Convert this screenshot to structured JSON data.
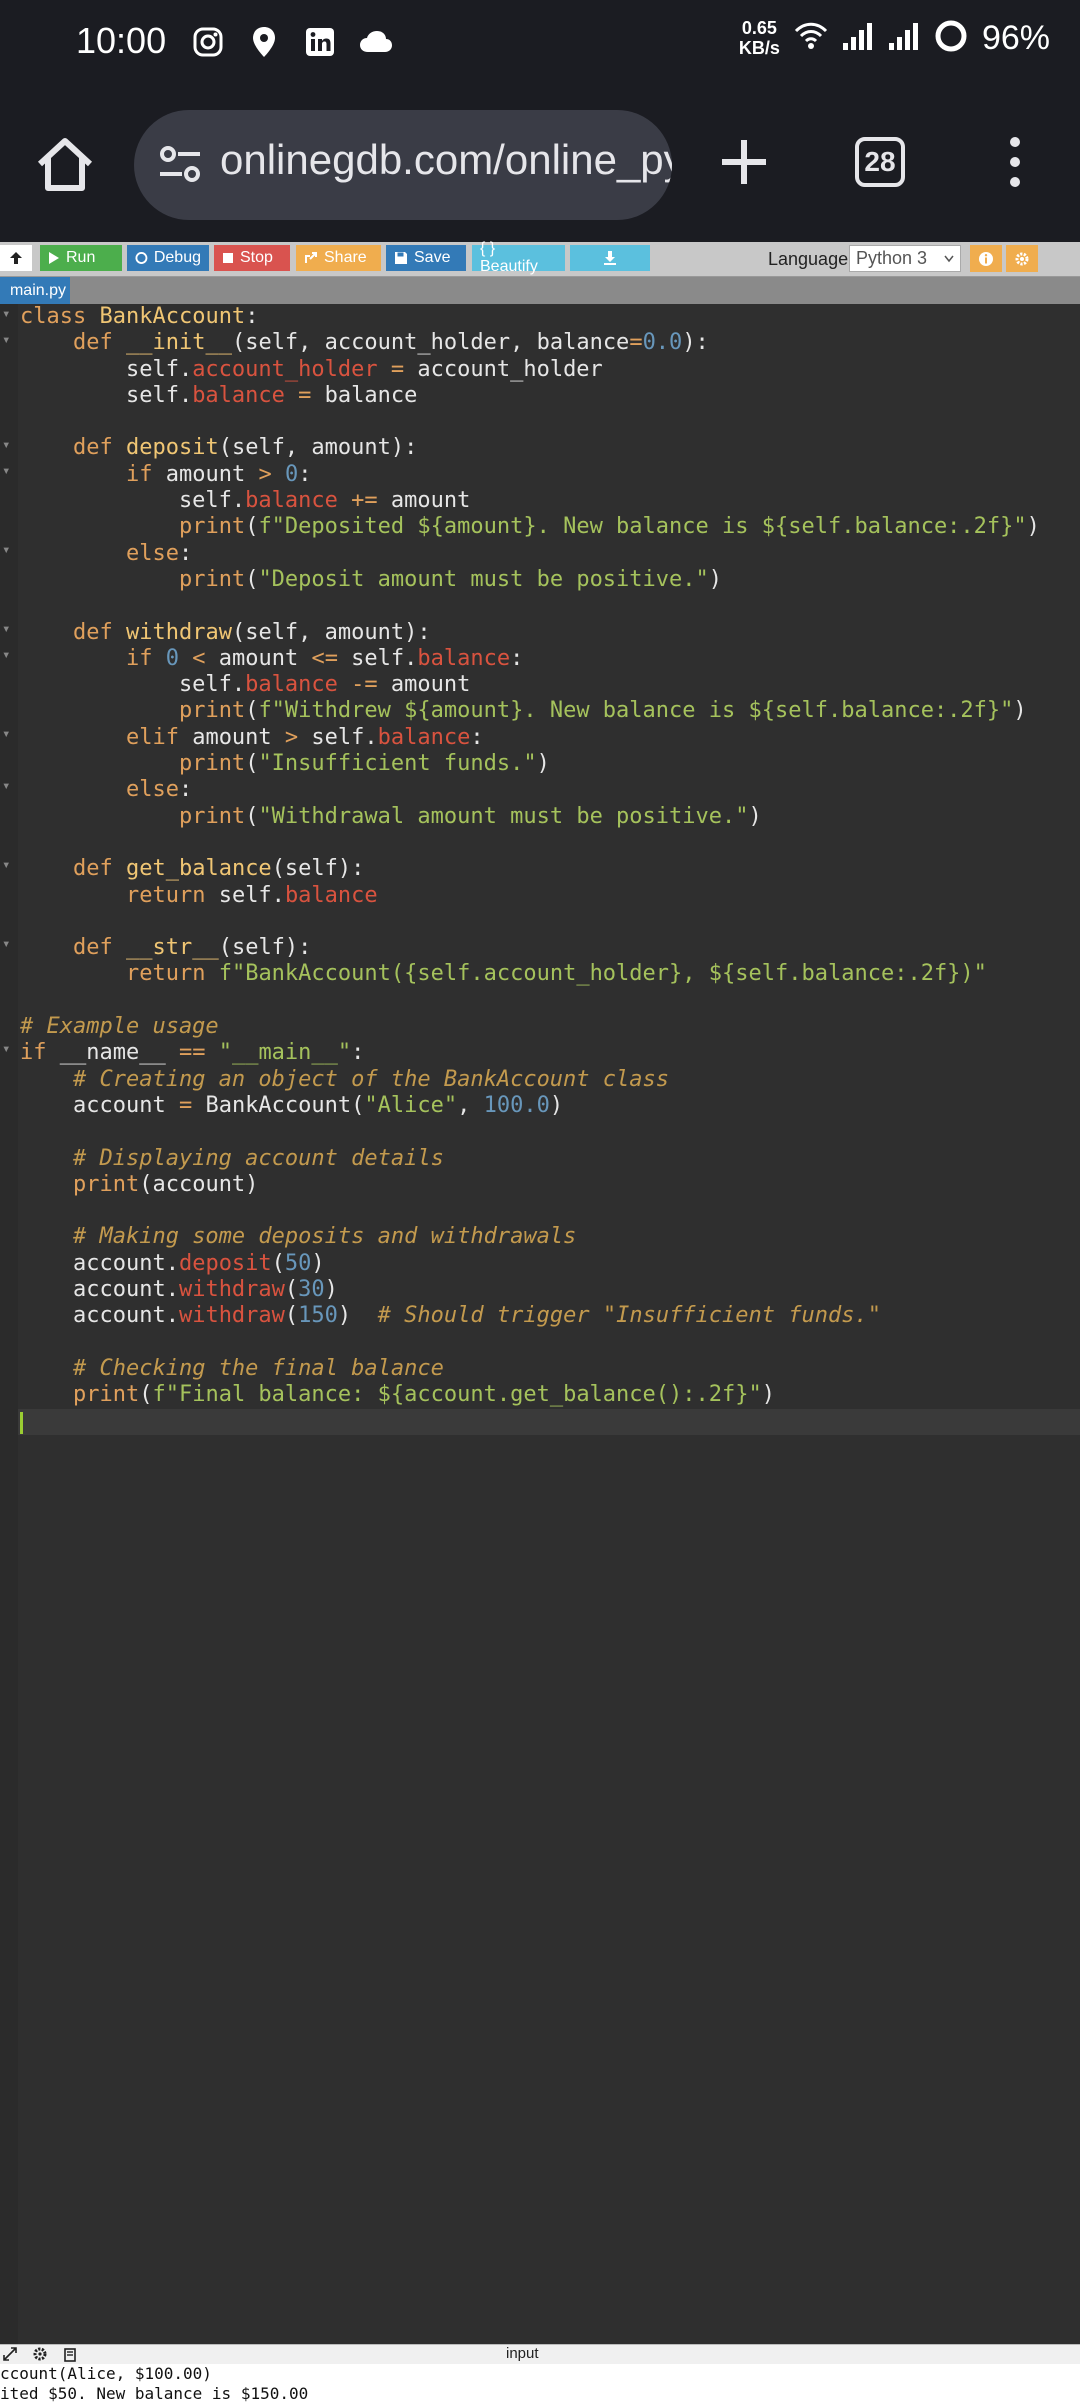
{
  "status_bar": {
    "time": "10:00",
    "speed_value": "0.65",
    "speed_unit": "KB/s",
    "battery": "96%",
    "icons": [
      "instagram-icon",
      "maps-pin-icon",
      "linkedin-icon",
      "cloud-icon",
      "wifi-icon",
      "signal-icon",
      "signal-icon",
      "battery-ring-icon"
    ]
  },
  "browser": {
    "url": "onlinegdb.com/online_python_compiler",
    "tab_count": "28"
  },
  "toolbar": {
    "run": "Run",
    "debug": "Debug",
    "stop": "Stop",
    "share": "Share",
    "save": "Save",
    "beautify": "{ } Beautify",
    "language_label": "Language",
    "language_value": "Python 3",
    "file_tab": "main.py"
  },
  "colors": {
    "run": "#4cae4c",
    "debug": "#337ab7",
    "stop": "#d9534f",
    "share": "#f0ad4e",
    "save": "#337ab7",
    "beautify": "#5bc0de",
    "download": "#5bc0de"
  },
  "code_lines": [
    "class BankAccount:",
    "    def __init__(self, account_holder, balance=0.0):",
    "        self.account_holder = account_holder",
    "        self.balance = balance",
    "",
    "    def deposit(self, amount):",
    "        if amount > 0:",
    "            self.balance += amount",
    "            print(f\"Deposited ${amount}. New balance is ${self.balance:.2f}\")",
    "        else:",
    "            print(\"Deposit amount must be positive.\")",
    "",
    "    def withdraw(self, amount):",
    "        if 0 < amount <= self.balance:",
    "            self.balance -= amount",
    "            print(f\"Withdrew ${amount}. New balance is ${self.balance:.2f}\")",
    "        elif amount > self.balance:",
    "            print(\"Insufficient funds.\")",
    "        else:",
    "            print(\"Withdrawal amount must be positive.\")",
    "",
    "    def get_balance(self):",
    "        return self.balance",
    "",
    "    def __str__(self):",
    "        return f\"BankAccount({self.account_holder}, ${self.balance:.2f})\"",
    "",
    "# Example usage",
    "if __name__ == \"__main__\":",
    "    # Creating an object of the BankAccount class",
    "    account = BankAccount(\"Alice\", 100.0)",
    "",
    "    # Displaying account details",
    "    print(account)",
    "",
    "    # Making some deposits and withdrawals",
    "    account.deposit(50)",
    "    account.withdraw(30)",
    "    account.withdraw(150)  # Should trigger \"Insufficient funds.\"",
    "",
    "    # Checking the final balance",
    "    print(f\"Final balance: ${account.get_balance():.2f}\")",
    ""
  ],
  "output": {
    "label": "input",
    "lines": [
      "ccount(Alice, $100.00)",
      "ited $50. New balance is $150.00"
    ]
  }
}
